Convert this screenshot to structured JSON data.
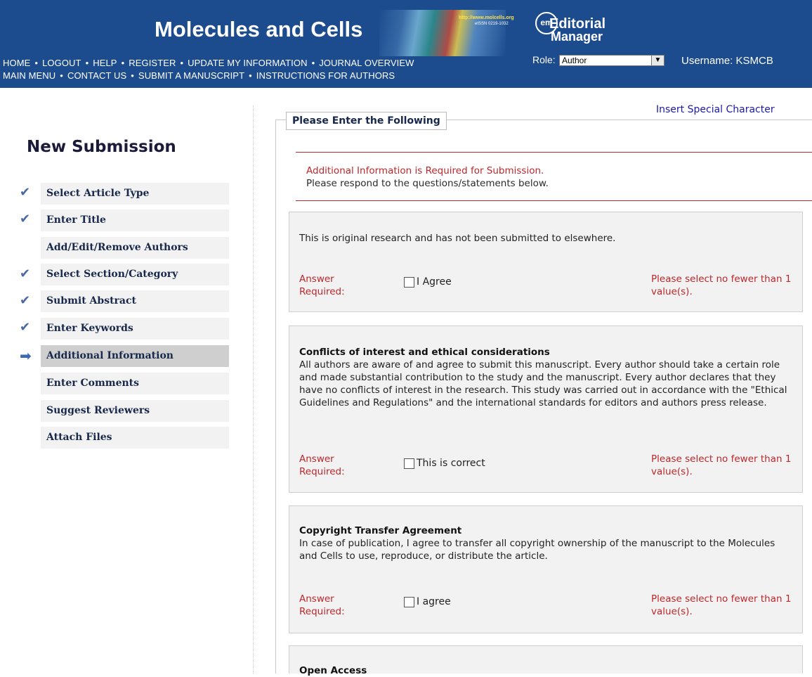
{
  "header": {
    "journal_title": "Molecules and Cells",
    "banner_url": "http://www.molcells.org",
    "banner_issn": "eISSN 0219-1032",
    "em_logo_badge": "em",
    "em_logo_line1": "Editorial",
    "em_logo_line2": "Manager",
    "nav_row1": [
      "HOME",
      "LOGOUT",
      "HELP",
      "REGISTER",
      "UPDATE MY INFORMATION",
      "JOURNAL OVERVIEW"
    ],
    "nav_row2": [
      "MAIN MENU",
      "CONTACT US",
      "SUBMIT A MANUSCRIPT",
      "INSTRUCTIONS FOR AUTHORS"
    ],
    "role_label": "Role:",
    "role_value": "Author",
    "username": "Username: KSMCB",
    "bg_color": "#1d4c8e"
  },
  "sidebar": {
    "heading": "New Submission",
    "steps": [
      {
        "label": "Select Article Type",
        "mark": "check"
      },
      {
        "label": "Enter Title",
        "mark": "check"
      },
      {
        "label": "Add/Edit/Remove Authors",
        "mark": "none"
      },
      {
        "label": "Select Section/Category",
        "mark": "check"
      },
      {
        "label": "Submit Abstract",
        "mark": "check"
      },
      {
        "label": "Enter Keywords",
        "mark": "check"
      },
      {
        "label": "Additional Information",
        "mark": "arrow"
      },
      {
        "label": "Enter Comments",
        "mark": "none"
      },
      {
        "label": "Suggest Reviewers",
        "mark": "none"
      },
      {
        "label": "Attach Files",
        "mark": "none"
      }
    ]
  },
  "main": {
    "insert_special_character": "Insert Special Character",
    "legend": "Please Enter the Following",
    "required_line1": "Additional Information is Required for Submission.",
    "required_line2": "Please respond to the questions/statements below.",
    "questions": [
      {
        "title": "",
        "text": "This is original research and has not been submitted to elsewhere.",
        "answer_required": "Answer Required:",
        "checkbox_label": "I Agree",
        "error": "Please select no fewer than 1 value(s)."
      },
      {
        "title": "Conflicts of interest and ethical considerations",
        "text": "All authors are aware of and agree to submit this manuscript. Every author should take a certain role and made substantial contribution to the study and the manuscript. Every author declares that they have no conflicts of interest in the research. This study was carried out in accordance with the \"Ethical Guidelines and Regulations\" and the international standards for editors and authors press release.",
        "answer_required": "Answer Required:",
        "checkbox_label": "This is correct",
        "error": "Please select no fewer than 1 value(s)."
      },
      {
        "title": "Copyright Transfer Agreement",
        "text": "In case of publication, I agree to transfer all copyright ownership of the manuscript to the Molecules and Cells to use, reproduce, or distribute the article.",
        "answer_required": "Answer Required:",
        "checkbox_label": "I agree",
        "error": "Please select no fewer than 1 value(s)."
      },
      {
        "title": "Open Access",
        "text": ""
      }
    ]
  }
}
